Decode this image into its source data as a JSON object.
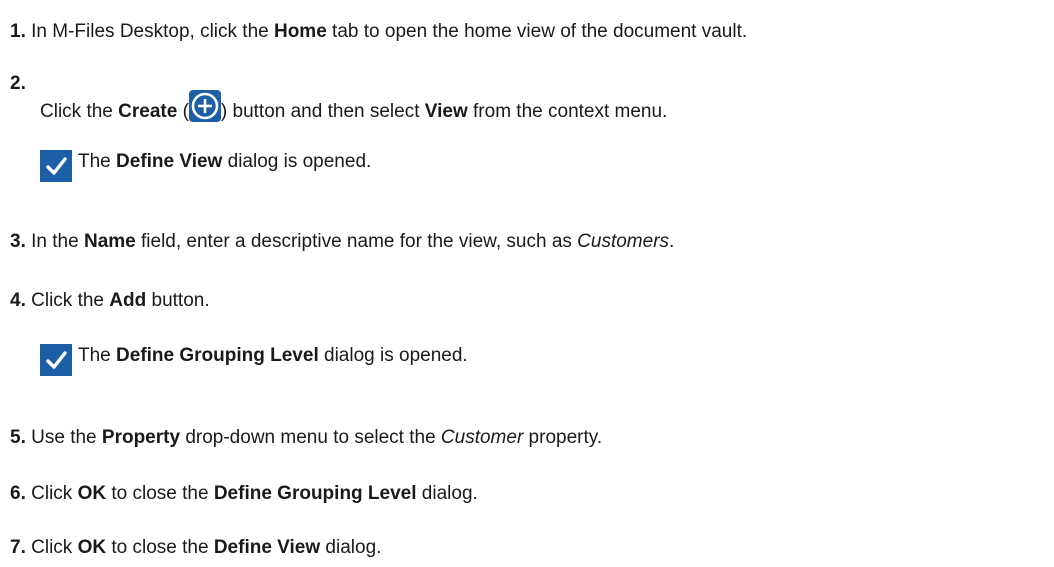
{
  "steps": [
    {
      "num": "1.",
      "a": "In M-Files Desktop, click the ",
      "b1": "Home",
      "c": " tab to open the home view of the document vault."
    },
    {
      "num": "2.",
      "a": "Click the ",
      "b1": "Create",
      "c": " (",
      "d": ") button and then select ",
      "b2": "View",
      "e": " from the context menu.",
      "result": {
        "a": "The ",
        "b": "Define View",
        "c": " dialog is opened."
      }
    },
    {
      "num": "3.",
      "a": "In the ",
      "b1": "Name",
      "c": " field, enter a descriptive name for the view, such as ",
      "i1": "Customers",
      "d": "."
    },
    {
      "num": "4.",
      "a": "Click the ",
      "b1": "Add",
      "c": " button.",
      "result": {
        "a": "The ",
        "b": "Define Grouping Level",
        "c": " dialog is opened."
      }
    },
    {
      "num": "5.",
      "a": "Use the ",
      "b1": "Property",
      "c": " drop-down menu to select the ",
      "i1": "Customer",
      "d": " property."
    },
    {
      "num": "6.",
      "a": "Click ",
      "b1": "OK",
      "c": " to close the ",
      "b2": "Define Grouping Level",
      "d": " dialog."
    },
    {
      "num": "7.",
      "a": "Click ",
      "b1": "OK",
      "c": " to close the ",
      "b2": "Define View",
      "d": " dialog."
    }
  ],
  "colors": {
    "icon_blue": "#1d5fa6",
    "text": "#1a1a1a"
  },
  "icons": {
    "create": "plus-circle-icon",
    "result": "checkmark-icon"
  }
}
